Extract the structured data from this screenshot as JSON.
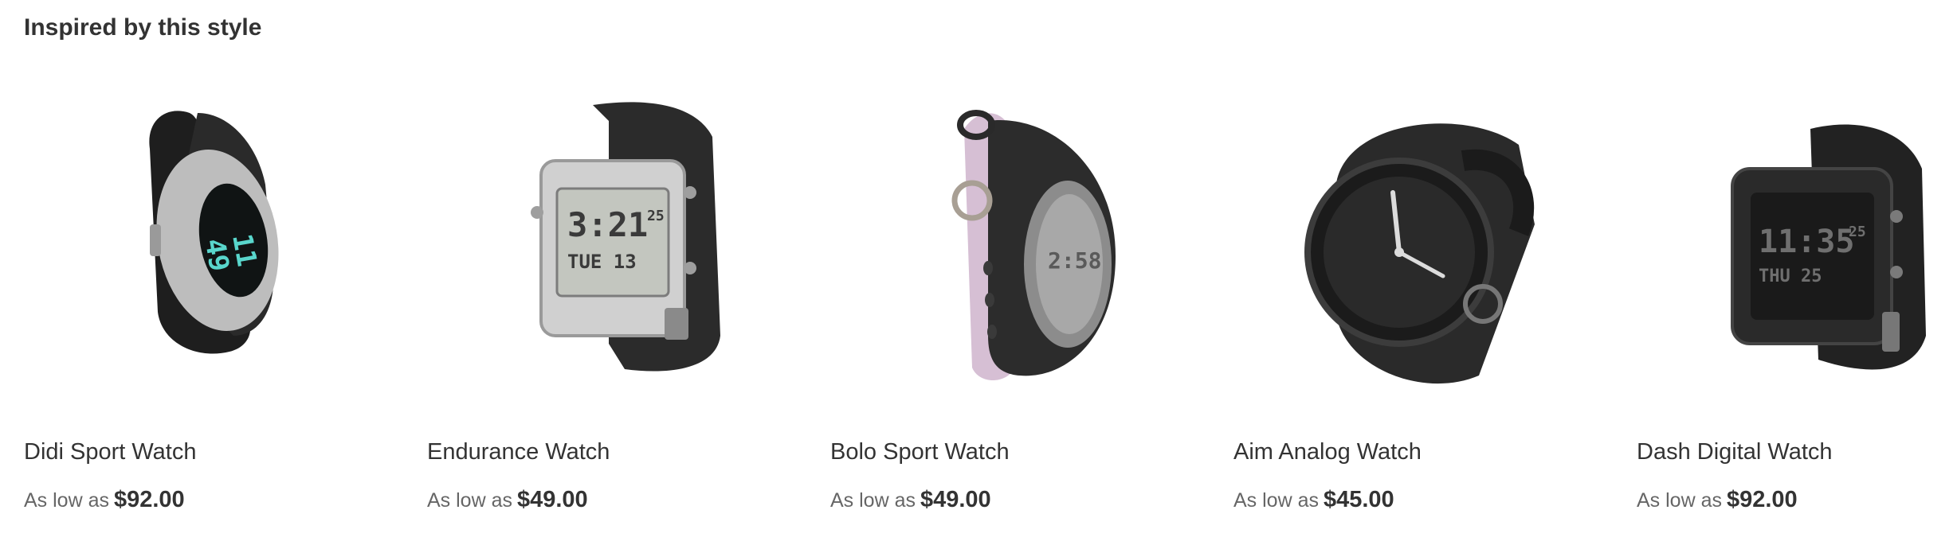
{
  "section": {
    "title": "Inspired by this style"
  },
  "products": [
    {
      "name": "Didi Sport Watch",
      "price_label": "As low as",
      "price": "$92.00"
    },
    {
      "name": "Endurance Watch",
      "price_label": "As low as",
      "price": "$49.00"
    },
    {
      "name": "Bolo Sport Watch",
      "price_label": "As low as",
      "price": "$49.00"
    },
    {
      "name": "Aim Analog Watch",
      "price_label": "As low as",
      "price": "$45.00"
    },
    {
      "name": "Dash Digital Watch",
      "price_label": "As low as",
      "price": "$92.00"
    }
  ],
  "images": {
    "p1": {
      "icon": "sport-watch-oval-digital-icon",
      "display_line1": "11",
      "display_line2": "49"
    },
    "p2": {
      "icon": "square-digital-watch-icon",
      "display_time": "3:21",
      "display_seconds": "25",
      "display_date": "TUE 13"
    },
    "p3": {
      "icon": "bolo-sport-watch-icon",
      "display_time": "2:58"
    },
    "p4": {
      "icon": "analog-watch-icon"
    },
    "p5": {
      "icon": "rectangular-digital-watch-icon",
      "display_time": "11:35",
      "display_seconds": "25",
      "display_date": "THU 25"
    }
  },
  "colors": {
    "text": "#333333",
    "muted": "#666666",
    "strap": "#2b2b2b",
    "silver": "#c8c8c8",
    "lilac": "#d8c0d6",
    "teal_display": "#59d6cc"
  }
}
